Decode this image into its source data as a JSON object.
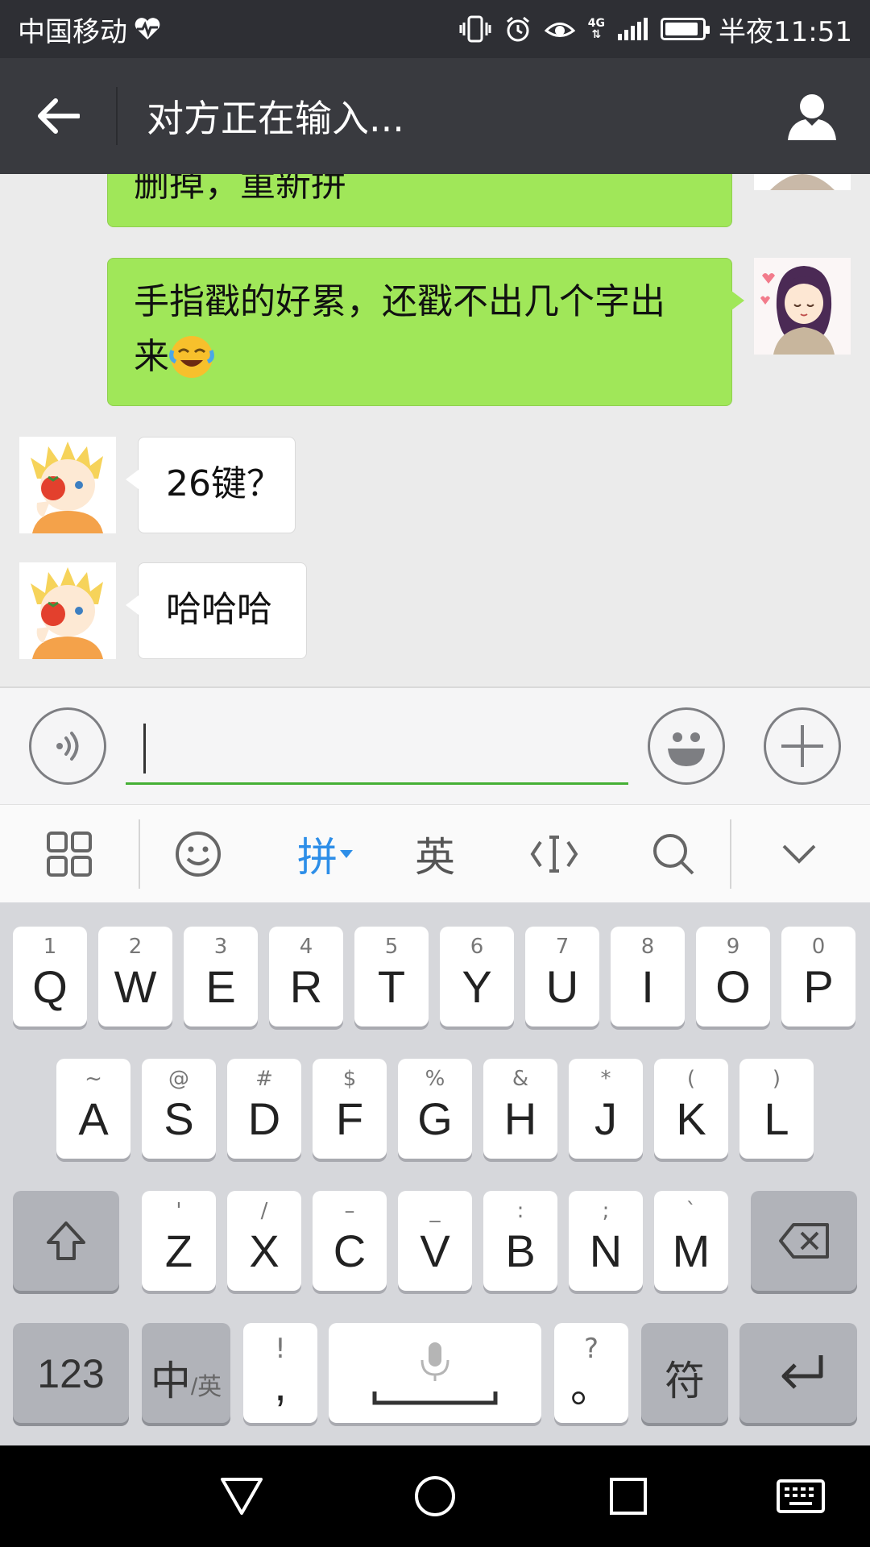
{
  "status_bar": {
    "carrier": "中国移动",
    "time": "半夜11:51",
    "network": "4G",
    "battery_level": 0.8
  },
  "header": {
    "title": "对方正在输入..."
  },
  "messages": [
    {
      "side": "right",
      "text": "删掉，重新拼",
      "partial": true
    },
    {
      "side": "right",
      "text": "手指戳的好累，还戳不出几个字出",
      "text_line2": "来"
    },
    {
      "side": "left",
      "text": "26键？"
    },
    {
      "side": "left",
      "text": "哈哈哈"
    }
  ],
  "input": {
    "value": ""
  },
  "ime_toolbar": {
    "pinyin_label": "拼",
    "english_label": "英"
  },
  "keyboard": {
    "row1": [
      {
        "alt": "1",
        "key": "Q"
      },
      {
        "alt": "2",
        "key": "W"
      },
      {
        "alt": "3",
        "key": "E"
      },
      {
        "alt": "4",
        "key": "R"
      },
      {
        "alt": "5",
        "key": "T"
      },
      {
        "alt": "6",
        "key": "Y"
      },
      {
        "alt": "7",
        "key": "U"
      },
      {
        "alt": "8",
        "key": "I"
      },
      {
        "alt": "9",
        "key": "O"
      },
      {
        "alt": "0",
        "key": "P"
      }
    ],
    "row2": [
      {
        "alt": "~",
        "key": "A"
      },
      {
        "alt": "@",
        "key": "S"
      },
      {
        "alt": "#",
        "key": "D"
      },
      {
        "alt": "$",
        "key": "F"
      },
      {
        "alt": "%",
        "key": "G"
      },
      {
        "alt": "&",
        "key": "H"
      },
      {
        "alt": "*",
        "key": "J"
      },
      {
        "alt": "(",
        "key": "K"
      },
      {
        "alt": ")",
        "key": "L"
      }
    ],
    "row3": [
      {
        "alt": "'",
        "key": "Z"
      },
      {
        "alt": "/",
        "key": "X"
      },
      {
        "alt": "–",
        "key": "C"
      },
      {
        "alt": "_",
        "key": "V"
      },
      {
        "alt": ":",
        "key": "B"
      },
      {
        "alt": ";",
        "key": "N"
      },
      {
        "alt": "`",
        "key": "M"
      }
    ],
    "num_label": "123",
    "lang_label_main": "中",
    "lang_label_sub": "/英",
    "comma_alt": "!",
    "comma_main": ",",
    "period_alt": "?",
    "period_main": "。",
    "symbol_label": "符"
  }
}
